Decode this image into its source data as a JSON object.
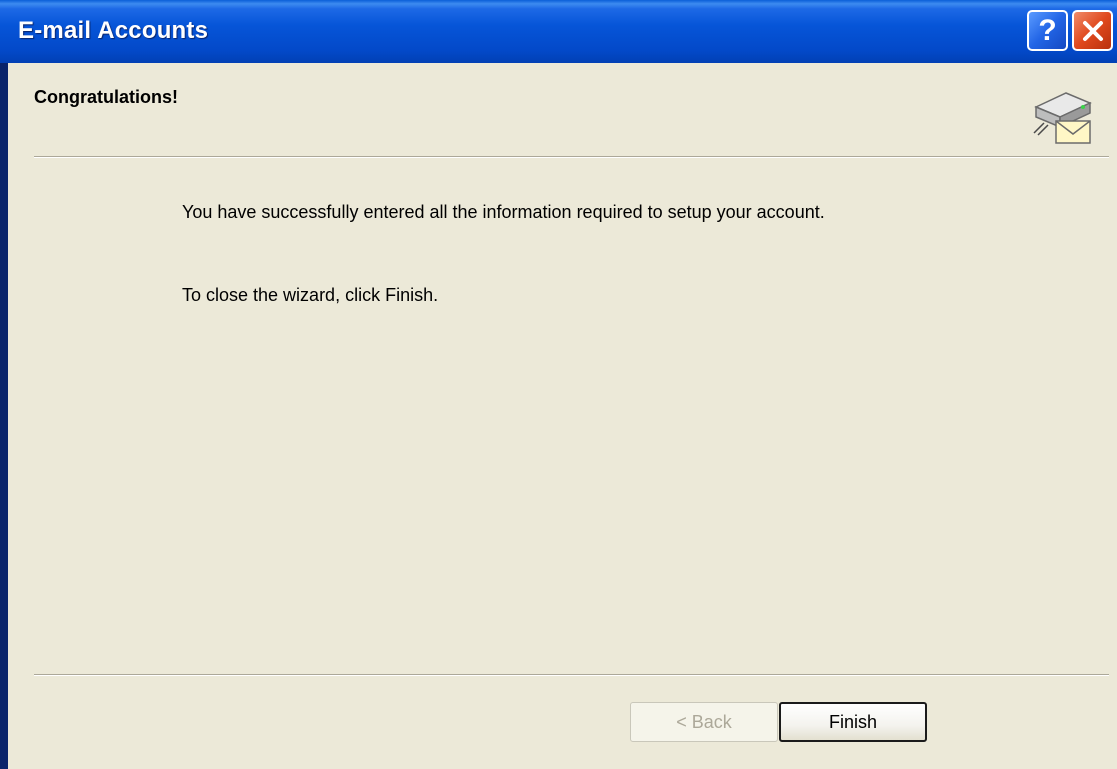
{
  "window": {
    "title": "E-mail Accounts",
    "help_icon": "help-icon",
    "close_icon": "close-icon"
  },
  "header": {
    "title": "Congratulations!",
    "icon": "mail-server-icon"
  },
  "body": {
    "line1": "You have successfully entered all the information required to setup your account.",
    "line2": "To close the wizard, click Finish."
  },
  "buttons": {
    "back_label": "< Back",
    "back_enabled": false,
    "finish_label": "Finish"
  },
  "colors": {
    "titlebar": "#0655d8",
    "client_bg": "#ece9d8",
    "close_button": "#e0491e",
    "help_button": "#2265e6"
  }
}
